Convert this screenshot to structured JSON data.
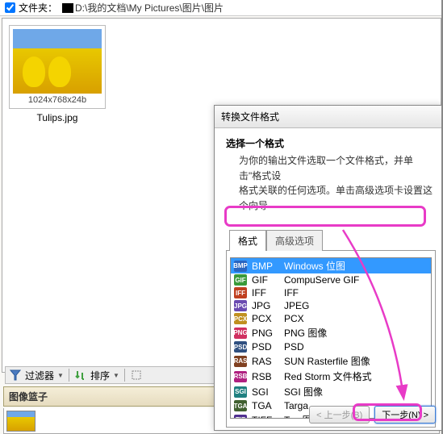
{
  "folder": {
    "label": "文件夹：",
    "path": "D:\\我的文档\\My Pictures\\图片\\图片"
  },
  "thumbnail": {
    "dimensions": "1024x768x24b",
    "filename": "Tulips.jpg"
  },
  "toolbar": {
    "filter_label": "过滤器",
    "sort_label": "排序"
  },
  "basket": {
    "title": "图像篮子"
  },
  "dialog": {
    "title": "转换文件格式",
    "heading": "选择一个格式",
    "desc1": "为你的输出文件选取一个文件格式，并单击\"格式设",
    "desc2": "格式关联的任何选项。单击高级选项卡设置这个向导",
    "tabs": {
      "format": "格式",
      "advanced": "高级选项"
    },
    "formats": [
      {
        "ext": "BMP",
        "desc": "Windows 位图",
        "color": "#2965c0",
        "selected": true
      },
      {
        "ext": "GIF",
        "desc": "CompuServe GIF",
        "color": "#3a9a3a"
      },
      {
        "ext": "IFF",
        "desc": "IFF",
        "color": "#c04020"
      },
      {
        "ext": "JPG",
        "desc": "JPEG",
        "color": "#6a4ab0"
      },
      {
        "ext": "PCX",
        "desc": "PCX",
        "color": "#c09020"
      },
      {
        "ext": "PNG",
        "desc": "PNG 图像",
        "color": "#d03060"
      },
      {
        "ext": "PSD",
        "desc": "PSD",
        "color": "#305080"
      },
      {
        "ext": "RAS",
        "desc": "SUN Rasterfile 图像",
        "color": "#804020"
      },
      {
        "ext": "RSB",
        "desc": "Red Storm 文件格式",
        "color": "#b02080"
      },
      {
        "ext": "SGI",
        "desc": "SGI 图像",
        "color": "#208080"
      },
      {
        "ext": "TGA",
        "desc": "Targa",
        "color": "#406030"
      },
      {
        "ext": "TIFF",
        "desc": "Tag 图像文件格式",
        "color": "#503090"
      }
    ],
    "buttons": {
      "back": "< 上一步(B)",
      "next": "下一步(N) >"
    }
  }
}
